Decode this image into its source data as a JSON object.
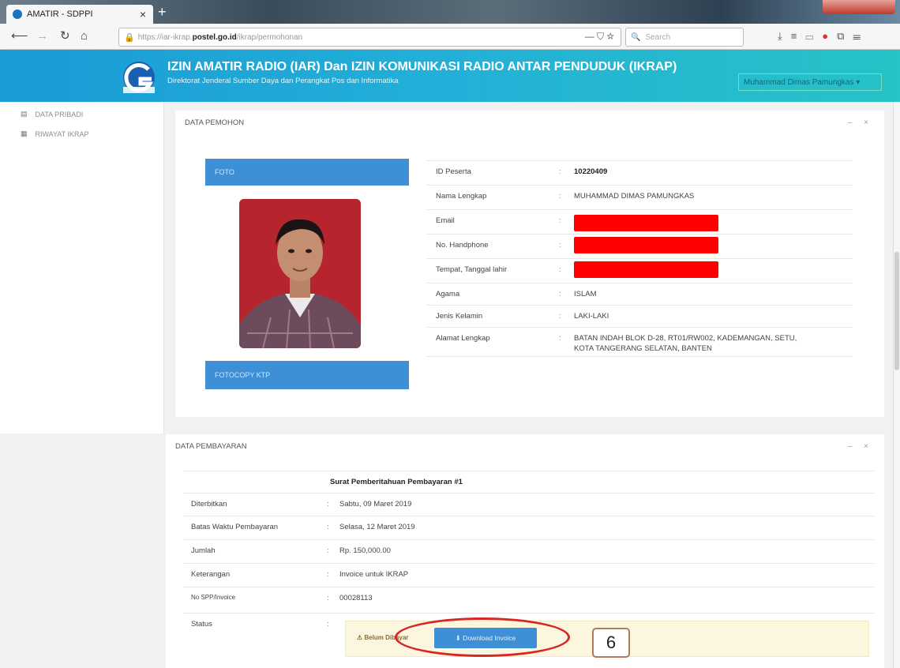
{
  "browser": {
    "tab_title": "AMATIR - SDPPI",
    "tab_close": "×",
    "new_tab": "+",
    "url_prefix": "https://iar-ikrap.",
    "url_domain": "postel.go.id",
    "url_path": "/ikrap/permohonan",
    "search_placeholder": "Search",
    "url_actions": "— ⛉ ☆"
  },
  "header": {
    "title": "IZIN AMATIR RADIO (IAR) Dan IZIN KOMUNIKASI RADIO ANTAR PENDUDUK (IKRAP)",
    "subtitle": "Direktorat Jenderal Sumber Daya dan Perangkat Pos dan Informatika",
    "user": "Muhammad Dimas Pamungkas ▾"
  },
  "sidebar": {
    "items": [
      {
        "label": "DATA PRIBADI"
      },
      {
        "label": "RIWAYAT IKRAP"
      }
    ]
  },
  "applicant": {
    "heading": "DATA PEMOHON",
    "panel_tools": "– ×",
    "photo_label": "FOTO",
    "ktp_label": "FOTOCOPY KTP",
    "rows": [
      {
        "label": "ID Peserta",
        "value": "10220409"
      },
      {
        "label": "Nama Lengkap",
        "value": "MUHAMMAD DIMAS PAMUNGKAS"
      },
      {
        "label": "Email",
        "value": ""
      },
      {
        "label": "No. Handphone",
        "value": ""
      },
      {
        "label": "Tempat, Tanggal lahir",
        "value": ""
      },
      {
        "label": "Agama",
        "value": "ISLAM"
      },
      {
        "label": "Jenis Kelamin",
        "value": "LAKI-LAKI"
      },
      {
        "label": "Alamat Lengkap",
        "value": "BATAN INDAH BLOK D-28, RT01/RW002, KADEMANGAN, SETU,",
        "value2": "KOTA TANGERANG SELATAN, BANTEN"
      }
    ],
    "separator": ":"
  },
  "payment": {
    "heading": "DATA PEMBAYARAN",
    "panel_tools": "– ×",
    "notice_title": "Surat Pemberitahuan Pembayaran #1",
    "rows": [
      {
        "label": "Diterbitkan",
        "value": "Sabtu, 09 Maret 2019"
      },
      {
        "label": "Batas Waktu Pembayaran",
        "value": "Selasa, 12 Maret 2019"
      },
      {
        "label": "Jumlah",
        "value": "Rp. 150,000.00"
      },
      {
        "label": "Keterangan",
        "value": "Invoice untuk IKRAP"
      },
      {
        "label": "No SPP/Invoice",
        "value": "00028113"
      },
      {
        "label": "Status",
        "value": ""
      }
    ],
    "status_text": "⚠ Belum Dibayar",
    "download_button": "⬇ Download Invoice"
  },
  "annotation": {
    "step_number": "6"
  },
  "colors": {
    "header_start": "#1a9bd5",
    "header_end": "#27c3c6",
    "primary_button": "#3e8fd6",
    "callout": "#d62626",
    "redaction": "#ff0000",
    "warning_bg": "#fcf6de"
  }
}
